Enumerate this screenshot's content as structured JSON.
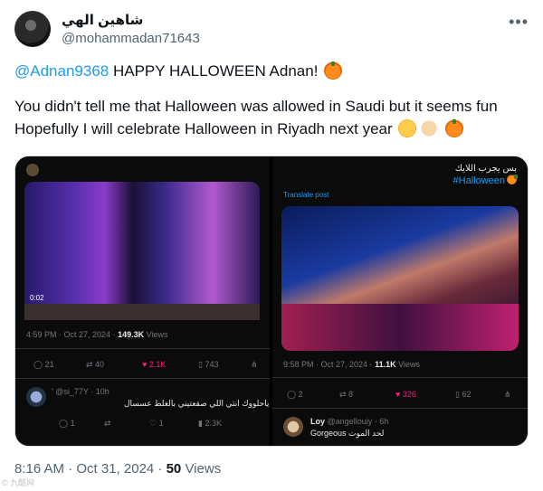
{
  "author": {
    "display_name": "شاهين الهي",
    "handle": "@mohammadan71643"
  },
  "menu_icon": "more-horizontal-icon",
  "tweet": {
    "mention": "@Adnan9368",
    "line1_rest": " HAPPY HALLOWEEN  Adnan! ",
    "line2": "You didn't tell me that Halloween was allowed in Saudi but it seems fun",
    "line3": "Hopefully I will celebrate Halloween in Riyadh next year "
  },
  "left_post": {
    "video_time": "0:02",
    "time": "4:59 PM · Oct 27, 2024 · ",
    "views_count": "149.3K",
    "views_label": " Views",
    "replies": "21",
    "reposts": "40",
    "likes": "2.1K",
    "bookmarks": "743",
    "reply": {
      "handle": "' @si_77Y · 10h",
      "text": "ياحلووك انتي اللي صقعتيني بالغلط عسسال",
      "replies": "1",
      "likes": "1",
      "views": "2.3K"
    }
  },
  "right_post": {
    "title": "بس يجرب اللايك",
    "hashtag": "#Halloween",
    "translate": "Translate post",
    "time": "9:58 PM · Oct 27, 2024 · ",
    "views_count": "11.1K",
    "views_label": " Views",
    "replies": "2",
    "reposts": "8",
    "likes": "326",
    "bookmarks": "62",
    "reply": {
      "name": "Loy",
      "handle": "@angellouiy · 6h",
      "text": "Gorgeous لحد الموت"
    }
  },
  "footer": {
    "time": "8:16 AM · Oct 31, 2024 · ",
    "views_count": "50",
    "views_label": " Views"
  },
  "watermark": "© 九酷网"
}
